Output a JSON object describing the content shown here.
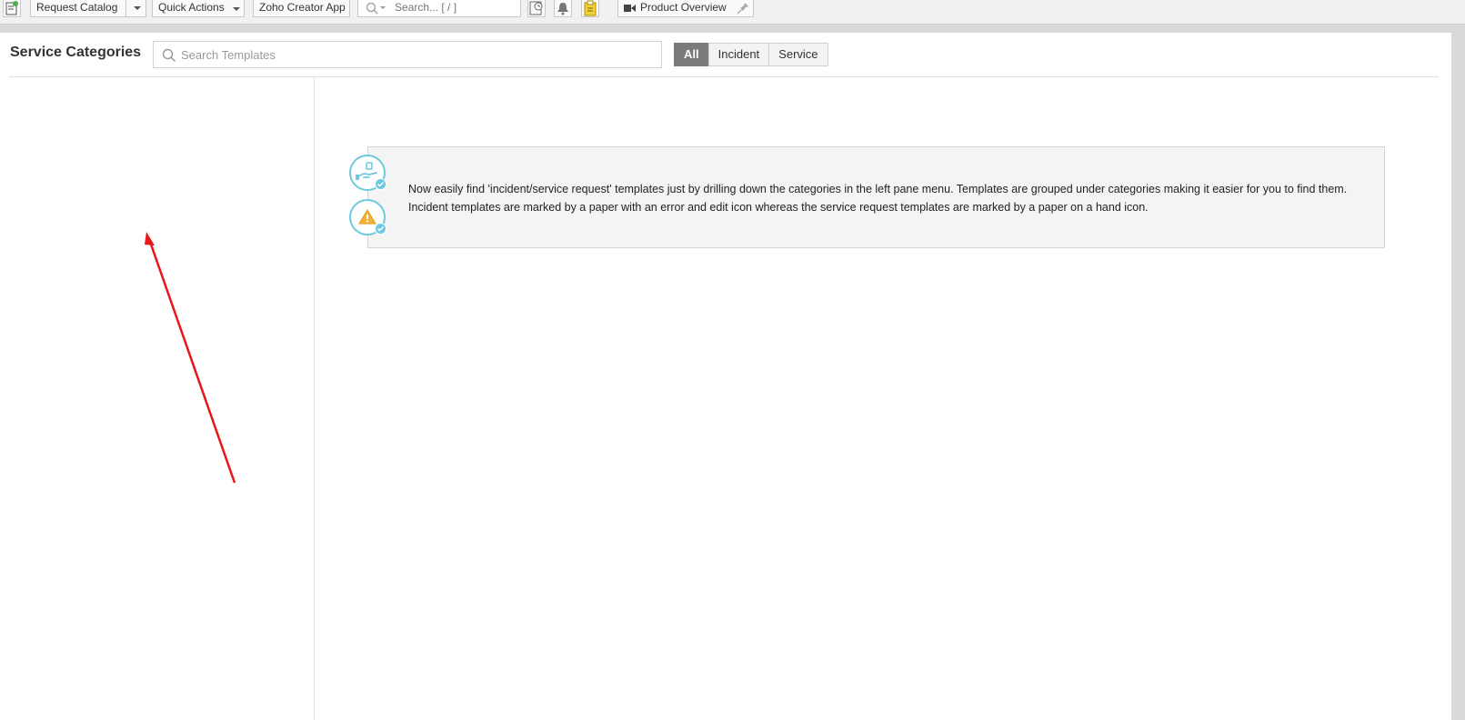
{
  "toolbar": {
    "request_catalog": "Request Catalog",
    "quick_actions": "Quick Actions",
    "zoho_creator": "Zoho Creator App",
    "search_placeholder": "Search... [ / ]",
    "product_overview": "Product Overview"
  },
  "panel": {
    "title": "Service Categories",
    "search_placeholder": "Search Templates",
    "filters": [
      "All",
      "Incident",
      "Service"
    ],
    "active_filter": "All"
  },
  "info": {
    "text": "Now easily find 'incident/service request' templates just by drilling down the categories in the left pane menu. Templates are grouped under categories making it easier for you to find them. Incident templates are marked by a paper with an error and edit icon whereas the service request templates are marked by a paper on a hand icon."
  },
  "colors": {
    "accent": "#6ec9e0",
    "active_filter_bg": "#7a7a7a",
    "annotation_arrow": "#e8161b",
    "warning": "#f3b23a"
  },
  "icons": {
    "new_request": "new-request-icon",
    "search": "search-icon",
    "reminders": "reminder-clock-icon",
    "notifications": "bell-icon",
    "tasks": "clipboard-icon",
    "video": "video-camera-icon",
    "pin": "pin-icon",
    "service_template": "hand-paper-icon",
    "incident_template": "warning-paper-icon"
  }
}
